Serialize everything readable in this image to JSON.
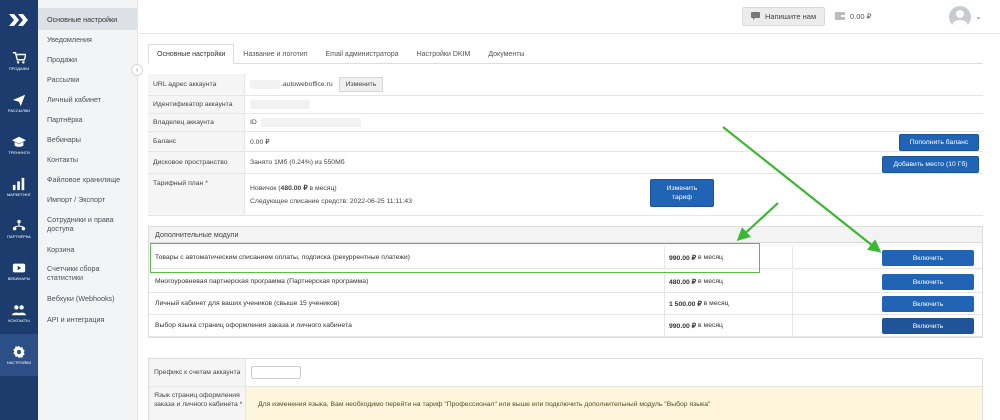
{
  "nav_rail": [
    {
      "icon": "chevrons-logo-icon",
      "label": ""
    },
    {
      "icon": "cart-icon",
      "label": "ПРОДАЖИ"
    },
    {
      "icon": "paper-plane-icon",
      "label": "РАССЫЛКИ"
    },
    {
      "icon": "graduation-cap-icon",
      "label": "ТРЕНИНГИ"
    },
    {
      "icon": "bar-chart-icon",
      "label": "МАРКЕТИНГ"
    },
    {
      "icon": "partners-icon",
      "label": "ПАРТНЁРКА"
    },
    {
      "icon": "video-icon",
      "label": "ВЕБИНАРЫ"
    },
    {
      "icon": "contacts-icon",
      "label": "КОНТАКТЫ"
    },
    {
      "icon": "gear-icon",
      "label": "НАСТРОЙКИ"
    }
  ],
  "sidebar": {
    "items": [
      {
        "label": "Основные настройки"
      },
      {
        "label": "Уведомления"
      },
      {
        "label": "Продажи"
      },
      {
        "label": "Рассылки"
      },
      {
        "label": "Личный кабинет"
      },
      {
        "label": "Партнёрка"
      },
      {
        "label": "Вебинары"
      },
      {
        "label": "Контакты"
      },
      {
        "label": "Файловое хранилище"
      },
      {
        "label": "Импорт / Экспорт"
      },
      {
        "label": "Сотрудники и права доступа"
      },
      {
        "label": "Корзина"
      },
      {
        "label": "Счетчики сбора статистики"
      },
      {
        "label": "Вебхуки (Webhooks)"
      },
      {
        "label": "API и интеграция"
      }
    ]
  },
  "topbar": {
    "write_button": "Напишите нам",
    "balance": "0.00 ₽"
  },
  "tabs": [
    {
      "label": "Основные настройки"
    },
    {
      "label": "Название и логотип"
    },
    {
      "label": "Email администратора"
    },
    {
      "label": "Настройки DKIM"
    },
    {
      "label": "Документы"
    }
  ],
  "settings": {
    "url_label": "URL адрес аккаунта",
    "url_value": ".autowebоffice.ru",
    "url_change_button": "Изменить",
    "id_label": "Идентификатор аккаунта",
    "owner_label": "Владелец аккаунта",
    "owner_value": "ID",
    "balance_label": "Баланс",
    "balance_value": "0.00 ₽",
    "balance_button": "Пополнить баланс",
    "disk_label": "Дисковое пространство",
    "disk_value": "Занято 1Мб (0.24%) из 550Мб",
    "disk_button": "Добавить место (10 Гб)",
    "tariff_label": "Тарифный план *",
    "tariff_name": "Новичок (",
    "tariff_price": "480.00 ₽",
    "tariff_suffix": " в месяц)",
    "tariff_next": "Следующее списание средств: 2022-06-25 11:11:43",
    "tariff_button": "Изменить тариф"
  },
  "modules": {
    "title": "Дополнительные модули",
    "rows": [
      {
        "name": "Товары с автоматическим списанием оплаты, подписка (рекуррентные платежи)",
        "price": "990.00 ₽",
        "period": "в месяц",
        "button": "Включить"
      },
      {
        "name": "Многоуровневая партнерская программа (Партнерская программа)",
        "price": "480.00 ₽",
        "period": "в месяц",
        "button": "Включить"
      },
      {
        "name": "Личный кабинет для ваших учеников (свыше 15 учеников)",
        "price": "1 500.00 ₽",
        "period": "в месяц",
        "button": "Включить"
      },
      {
        "name": "Выбор языка страниц оформления заказа и личного кабинета",
        "price": "990.00 ₽",
        "period": "в месяц",
        "button": "Включить"
      }
    ]
  },
  "bottom": {
    "prefix_label": "Префикс к счетам аккаунта",
    "lang_label": "Язык страниц оформления заказа и личного кабинета *",
    "lang_notice": "Для изменения языка, Вам необходимо перейти на тариф \"Профессионал\" или выше или подключить дополнительный модуль \"Выбор языка\""
  },
  "colors": {
    "rail": "#1d3c6e",
    "accent_blue": "#2164b6",
    "annotation_green": "#3cb832",
    "notice_bg": "#fdf5dc"
  }
}
